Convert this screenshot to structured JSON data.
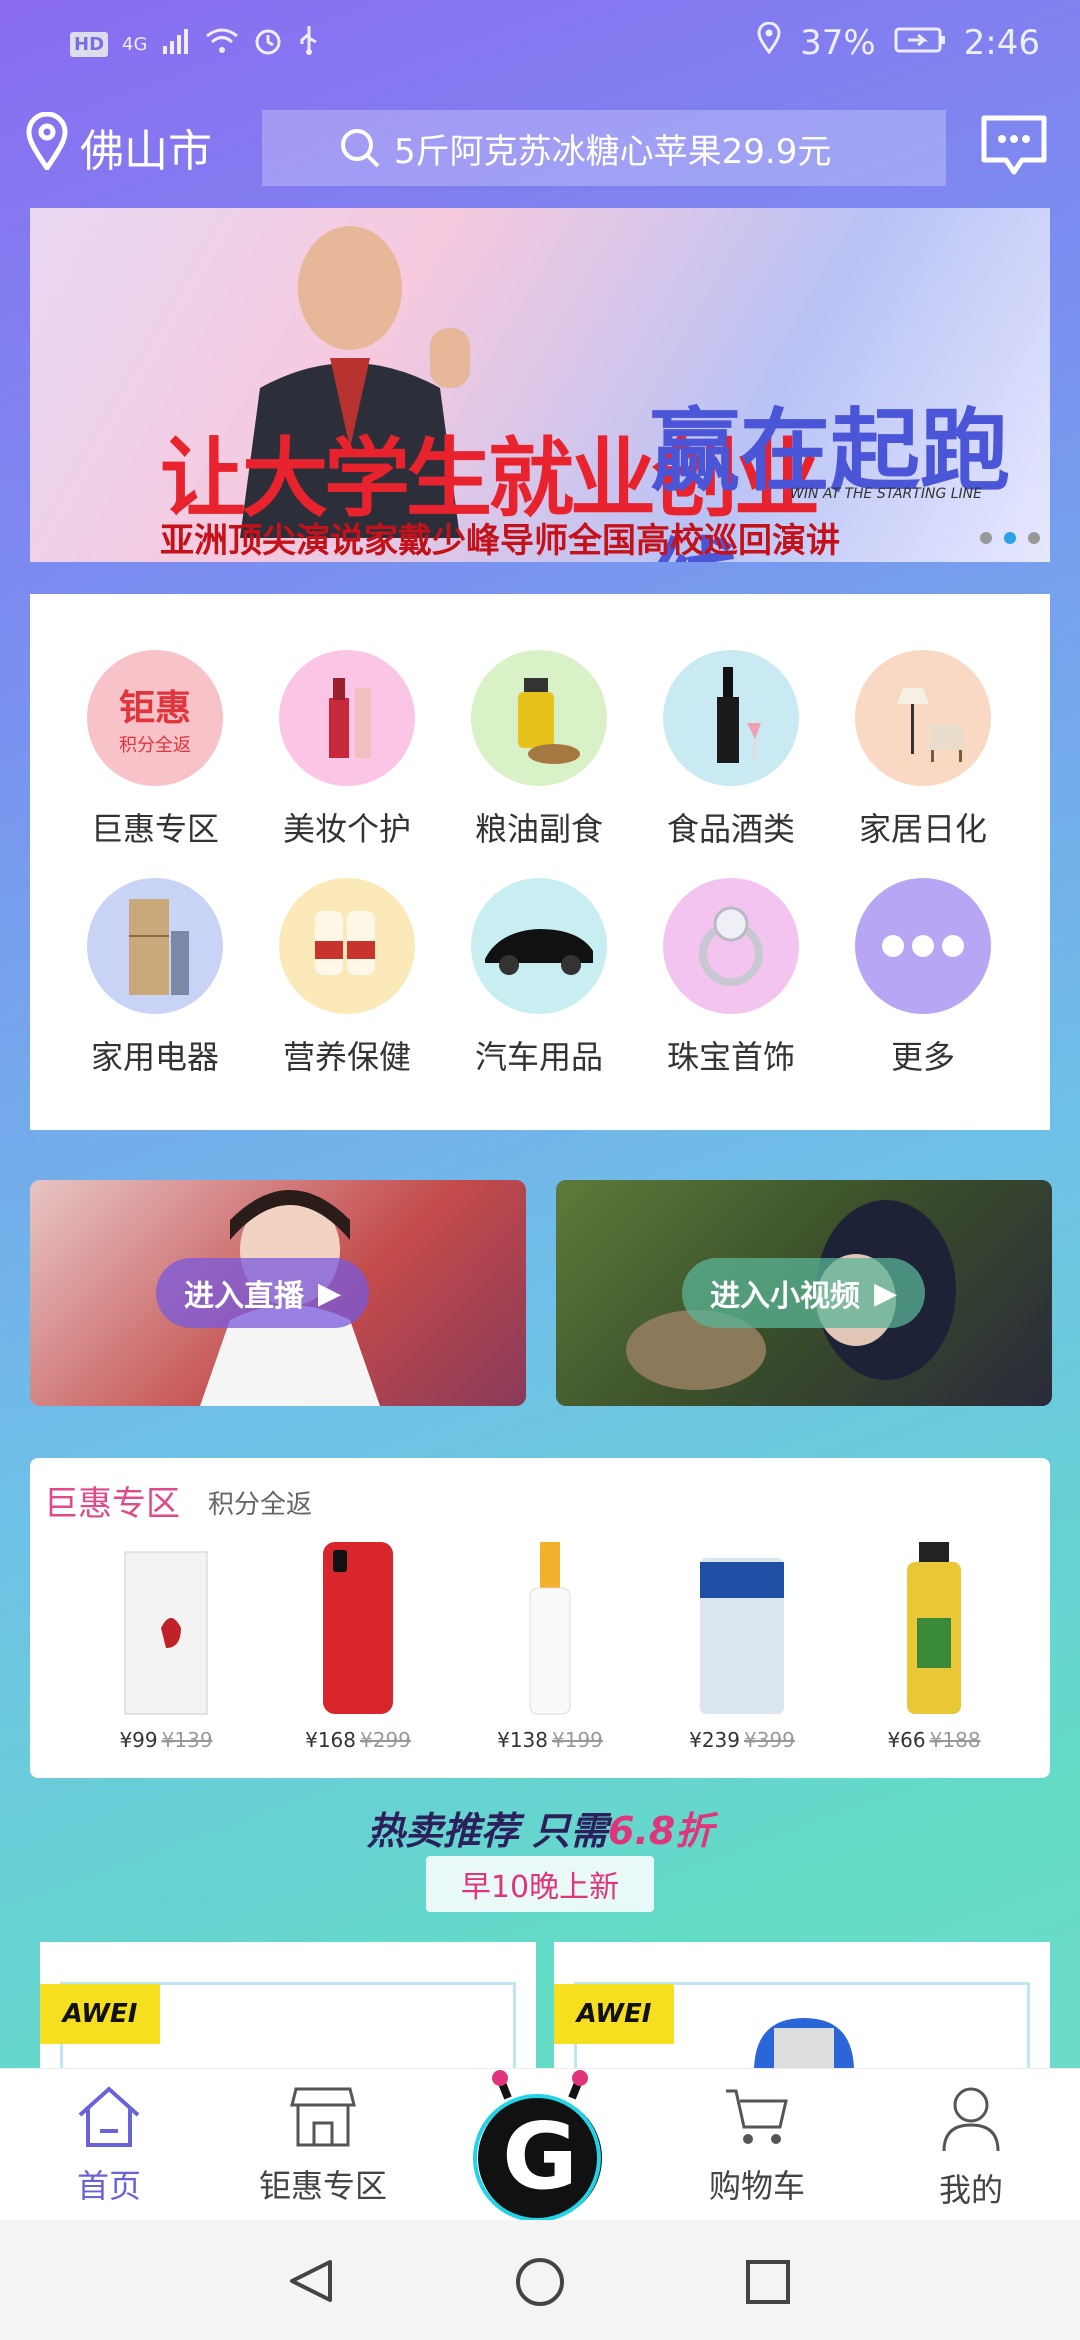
{
  "status_bar": {
    "left_icons": [
      "hd-icon",
      "signal-4g-icon",
      "wifi-icon",
      "alarm-icon",
      "usb-icon"
    ],
    "hd": "HD",
    "network": "4G",
    "battery": "37%",
    "time": "2:46"
  },
  "header": {
    "city": "佛山市",
    "search_text": "5斤阿克苏冰糖心苹果29.9元"
  },
  "banner": {
    "headline_left": "让大学生就业创业",
    "headline_right": "赢在起跑线",
    "english": "WIN AT THE STARTING LINE",
    "caption": "亚洲顶尖演说家戴少峰导师全国高校巡回演讲",
    "slides": 3,
    "active_slide": 2
  },
  "categories": [
    {
      "label": "巨惠专区",
      "icon_text": "钜惠",
      "icon_sub": "积分全返",
      "color": "#f8c3c8"
    },
    {
      "label": "美妆个护",
      "color": "#fbc6e6"
    },
    {
      "label": "粮油副食",
      "color": "#d8f1c7"
    },
    {
      "label": "食品酒类",
      "color": "#c9eaf3"
    },
    {
      "label": "家居日化",
      "color": "#f9d9c4"
    },
    {
      "label": "家用电器",
      "color": "#c9d3f5"
    },
    {
      "label": "营养保健",
      "color": "#fbe9b9"
    },
    {
      "label": "汽车用品",
      "color": "#c9eef1"
    },
    {
      "label": "珠宝首饰",
      "color": "#f4c4f1"
    },
    {
      "label": "更多",
      "color": "#b8a6f5"
    }
  ],
  "promos": {
    "live": "进入直播",
    "video": "进入小视频"
  },
  "deal": {
    "title": "巨惠专区",
    "subtitle": "积分全返",
    "products": [
      {
        "price": "¥99",
        "old": "¥139",
        "color": "#eeeeee"
      },
      {
        "price": "¥168",
        "old": "¥299",
        "color": "#d8262c"
      },
      {
        "price": "¥138",
        "old": "¥199",
        "color": "#f3b02a"
      },
      {
        "price": "¥239",
        "old": "¥399",
        "color": "#dbe5ef"
      },
      {
        "price": "¥66",
        "old": "¥188",
        "color": "#e9c737"
      }
    ]
  },
  "hot": {
    "title_prefix": "热卖推荐 只需",
    "title_accent": "6.8折",
    "badge": "早10晚上新"
  },
  "cards": {
    "brand": "AWEI"
  },
  "bottom_nav": {
    "home": "首页",
    "deals": "钜惠专区",
    "cart": "购物车",
    "me": "我的",
    "center": "G"
  }
}
